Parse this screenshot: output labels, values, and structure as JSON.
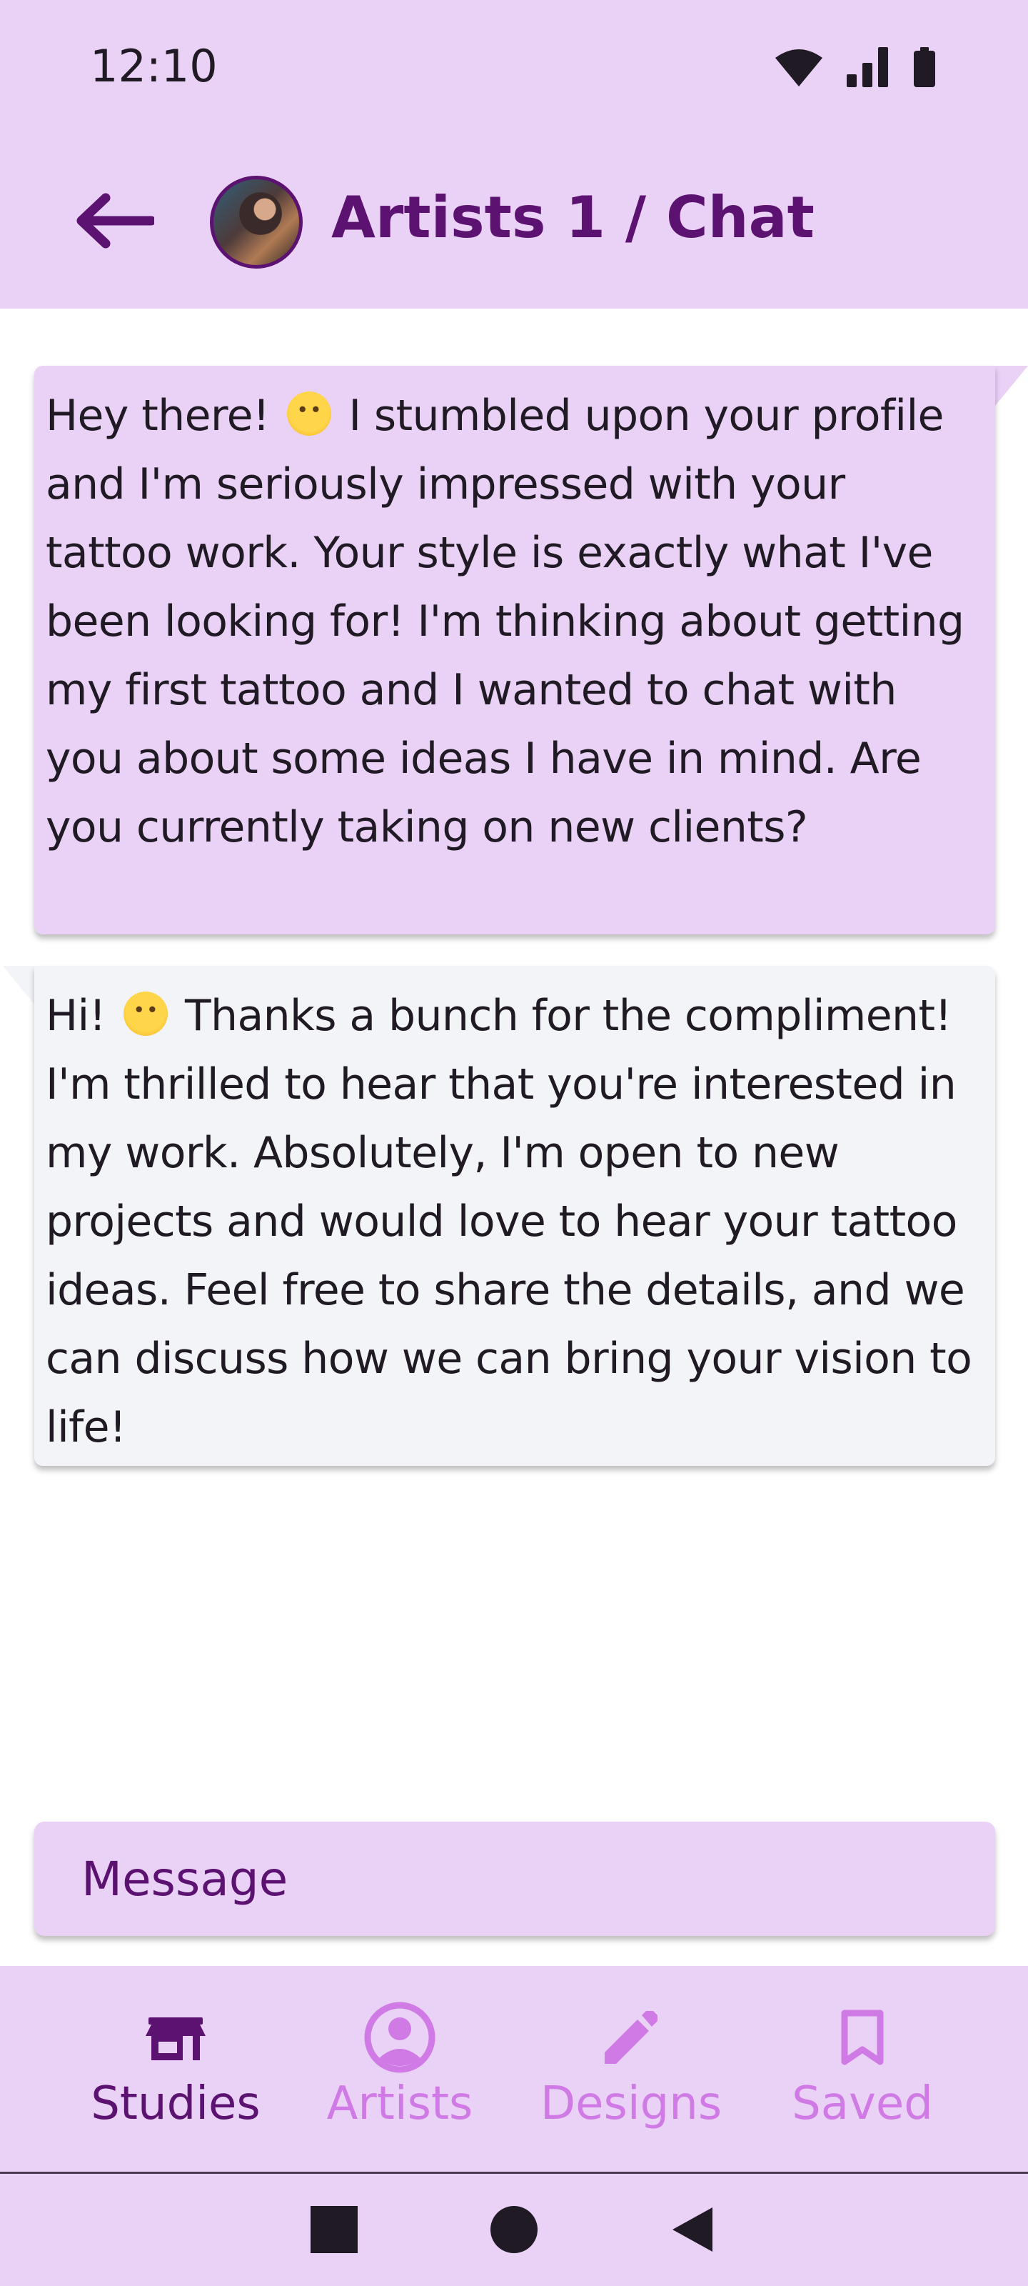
{
  "status_bar": {
    "time": "12:10"
  },
  "app_bar": {
    "title": "Artists 1 / Chat"
  },
  "messages": [
    {
      "side": "sent",
      "text_before_emoji": " Hey there! ",
      "text_after_emoji": " I stumbled upon your profile and I'm seriously impressed with your tattoo work. Your style is exactly what I've been looking for! I'm thinking about getting my first tattoo and I wanted to chat with you about some ideas I have in mind. Are you currently taking on new clients?"
    },
    {
      "side": "received",
      "text_before_emoji": "Hi! ",
      "text_after_emoji": " Thanks a bunch for the compliment! I'm thrilled to hear that you're interested in my work. Absolutely, I'm open to new projects and would love to hear your tattoo ideas. Feel free to share the details, and we can discuss how we can bring your vision to life!"
    }
  ],
  "composer": {
    "placeholder": "Message"
  },
  "bottom_nav": {
    "items": [
      {
        "label": "Studies",
        "icon": "store-icon",
        "active": true
      },
      {
        "label": "Artists",
        "icon": "account-circle-icon",
        "active": false
      },
      {
        "label": "Designs",
        "icon": "pencil-icon",
        "active": false
      },
      {
        "label": "Saved",
        "icon": "bookmark-icon",
        "active": false
      }
    ]
  },
  "colors": {
    "surface": "#ead1f6",
    "primary": "#5b1270",
    "inactive": "#d07ae6",
    "received_bubble": "#f3f4f8"
  }
}
